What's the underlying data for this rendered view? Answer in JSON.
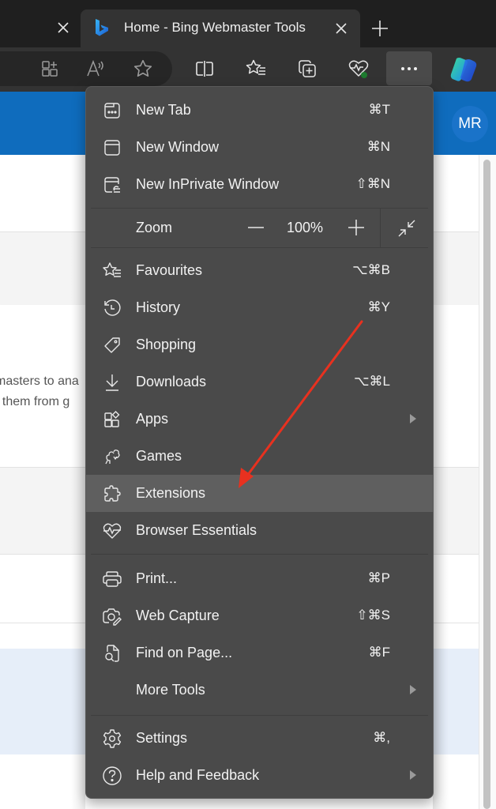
{
  "browser": {
    "tabs": [
      {
        "title": "",
        "active": false
      },
      {
        "title": "Home - Bing Webmaster Tools",
        "active": true,
        "favicon": "bing-logo-icon"
      }
    ],
    "new_tab_glyph": "+",
    "toolbar_icons": [
      "add-tab-icon",
      "read-aloud-icon",
      "favorite-star-icon",
      "split-screen-icon",
      "favorites-list-icon",
      "collections-icon",
      "browser-essentials-icon",
      "more-options-icon",
      "copilot-icon"
    ],
    "more_glyph": "•••"
  },
  "page": {
    "avatar_initials": "MR",
    "snippet_line_1": "masters to ana",
    "snippet_line_2": "t them from g",
    "colors": {
      "header": "#0f6cbd",
      "highlight": "#e6eef9"
    }
  },
  "menu": {
    "items_top": [
      {
        "label": "New Tab",
        "shortcut": "⌘T",
        "icon": "new-tab-icon"
      },
      {
        "label": "New Window",
        "shortcut": "⌘N",
        "icon": "new-window-icon"
      },
      {
        "label": "New InPrivate Window",
        "shortcut": "⇧⌘N",
        "icon": "inprivate-window-icon"
      }
    ],
    "zoom": {
      "label": "Zoom",
      "minus": "—",
      "value": "100%",
      "plus": "+"
    },
    "items_mid": [
      {
        "label": "Favourites",
        "shortcut": "⌥⌘B",
        "icon": "favourites-icon"
      },
      {
        "label": "History",
        "shortcut": "⌘Y",
        "icon": "history-icon"
      },
      {
        "label": "Shopping",
        "shortcut": "",
        "icon": "shopping-tag-icon"
      },
      {
        "label": "Downloads",
        "shortcut": "⌥⌘L",
        "icon": "download-icon"
      },
      {
        "label": "Apps",
        "shortcut": "",
        "icon": "apps-icon",
        "submenu": true
      },
      {
        "label": "Games",
        "shortcut": "",
        "icon": "games-icon"
      },
      {
        "label": "Extensions",
        "shortcut": "",
        "icon": "extensions-puzzle-icon",
        "highlighted": true
      },
      {
        "label": "Browser Essentials",
        "shortcut": "",
        "icon": "browser-essentials-heart-icon"
      }
    ],
    "items_tools": [
      {
        "label": "Print...",
        "shortcut": "⌘P",
        "icon": "print-icon"
      },
      {
        "label": "Web Capture",
        "shortcut": "⇧⌘S",
        "icon": "web-capture-icon"
      },
      {
        "label": "Find on Page...",
        "shortcut": "⌘F",
        "icon": "find-on-page-icon"
      },
      {
        "label": "More Tools",
        "shortcut": "",
        "icon": "",
        "submenu": true
      }
    ],
    "items_bottom": [
      {
        "label": "Settings",
        "shortcut": "⌘,",
        "icon": "settings-gear-icon"
      },
      {
        "label": "Help and Feedback",
        "shortcut": "",
        "icon": "help-question-icon",
        "submenu": true
      }
    ]
  },
  "annotation": {
    "type": "arrow",
    "color": "#e8311f",
    "points_to": "Extensions"
  }
}
